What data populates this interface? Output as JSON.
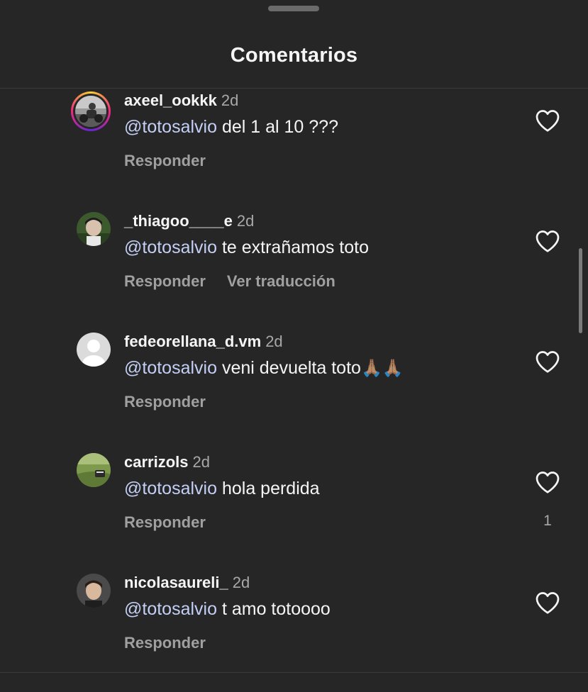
{
  "sheet": {
    "title": "Comentarios"
  },
  "comments": [
    {
      "username": "axeel_ookkk",
      "time": "2d",
      "mention": "@totosalvio",
      "text": "del 1 al 10 ???",
      "reply_label": "Responder",
      "has_story_ring": true
    },
    {
      "username": "_thiagoo____e",
      "time": "2d",
      "mention": "@totosalvio",
      "text": "te extrañamos toto",
      "reply_label": "Responder",
      "translate_label": "Ver traducción"
    },
    {
      "username": "fedeorellana_d.vm",
      "time": "2d",
      "mention": "@totosalvio",
      "text": "veni devuelta toto",
      "emoji": "🙏🏽🙏🏽",
      "reply_label": "Responder"
    },
    {
      "username": "carrizols",
      "time": "2d",
      "mention": "@totosalvio",
      "text": "hola perdida",
      "reply_label": "Responder",
      "like_count": "1"
    },
    {
      "username": "nicolasaureli_",
      "time": "2d",
      "mention": "@totosalvio",
      "text": "t amo totoooo",
      "reply_label": "Responder"
    }
  ],
  "icons": {
    "like": "heart-outline-icon",
    "default_avatar": "default-avatar-icon"
  },
  "colors": {
    "background": "#262626",
    "mention": "#c3cff5",
    "secondary_text": "#a8a8a8"
  }
}
